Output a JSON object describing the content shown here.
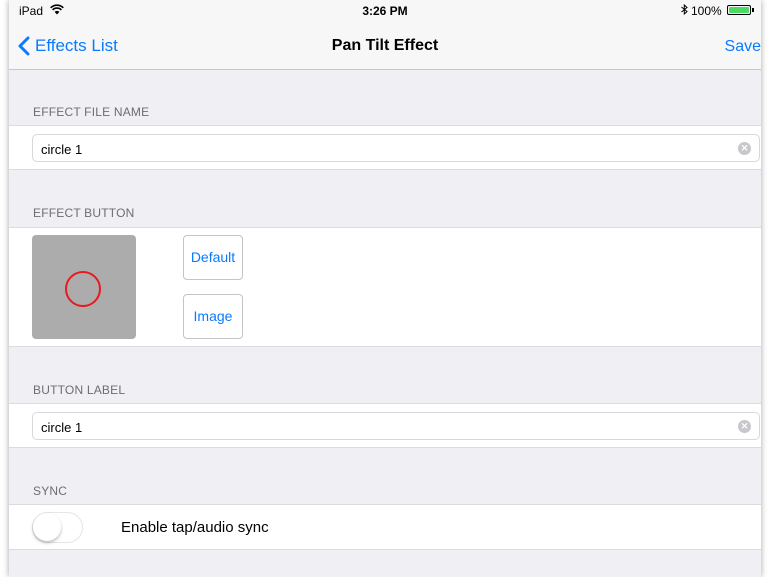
{
  "status_bar": {
    "carrier": "iPad",
    "wifi_icon": "wifi-icon",
    "time": "3:26 PM",
    "bluetooth_icon": "bluetooth-icon",
    "battery": "100%",
    "battery_level": 1.0,
    "battery_color": "#4cd964"
  },
  "nav": {
    "back_label": "Effects List",
    "title": "Pan Tilt Effect",
    "save_label": "Save",
    "accent": "#0a7aff"
  },
  "sections": {
    "file_name": {
      "header": "EFFECT FILE NAME",
      "value": "circle 1"
    },
    "effect_button": {
      "header": "EFFECT BUTTON",
      "default_label": "Default",
      "image_label": "Image",
      "preview_ring_color": "#e8191f"
    },
    "button_label": {
      "header": "BUTTON LABEL",
      "value": "circle 1"
    },
    "sync": {
      "header": "SYNC",
      "toggle_label": "Enable tap/audio sync",
      "enabled": false
    }
  }
}
